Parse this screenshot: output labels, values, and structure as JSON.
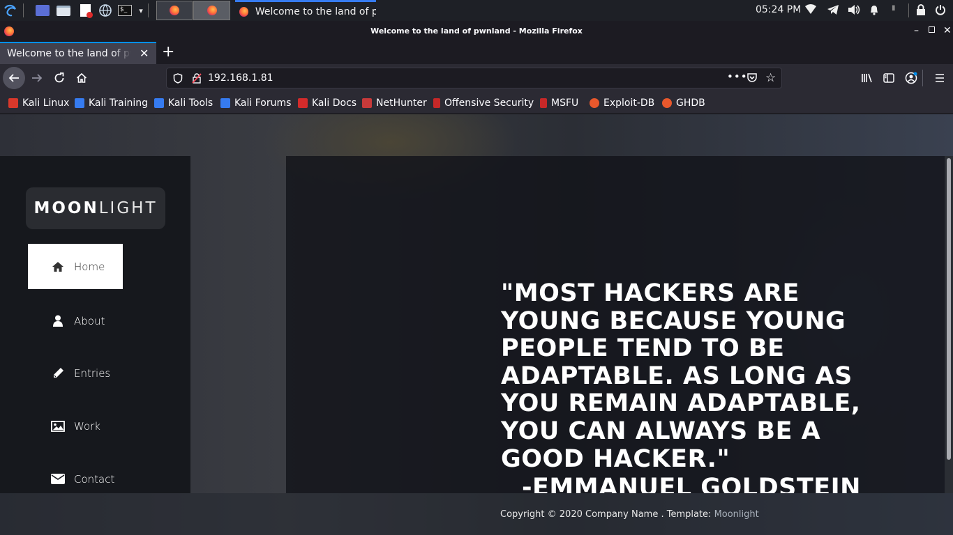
{
  "taskbar": {
    "window_title": "Welcome to the land of p...",
    "clock": "05:24 PM"
  },
  "browser": {
    "title": "Welcome to the land of pwnland - Mozilla Firefox",
    "tab_title": "Welcome to the land of pwnland",
    "url": "192.168.1.81",
    "bookmarks": [
      "Kali Linux",
      "Kali Training",
      "Kali Tools",
      "Kali Forums",
      "Kali Docs",
      "NetHunter",
      "Offensive Security",
      "MSFU",
      "Exploit-DB",
      "GHDB"
    ]
  },
  "site": {
    "logo_bold": "MOON",
    "logo_light": "LIGHT",
    "nav": [
      "Home",
      "About",
      "Entries",
      "Work",
      "Contact"
    ],
    "active_nav": "Home",
    "quote": "\"MOST HACKERS ARE YOUNG BECAUSE YOUNG PEOPLE TEND TO BE ADAPTABLE. AS LONG AS YOU REMAIN ADAPTABLE, YOU CAN ALWAYS BE A GOOD HACKER.\"",
    "author": "-EMMANUEL GOLDSTEIN",
    "footer_text": "Copyright © 2020 Company Name . Template: ",
    "footer_link": "Moonlight"
  },
  "icons": {
    "home": "home-icon",
    "about": "user-icon",
    "entries": "pencil-icon",
    "work": "image-icon",
    "contact": "envelope-icon"
  },
  "colors": {
    "tab_accent": "#0090ed",
    "taskbar_accent": "#367bf0",
    "sidebar_bg": "#16181d",
    "active_nav_bg": "#ffffff"
  }
}
